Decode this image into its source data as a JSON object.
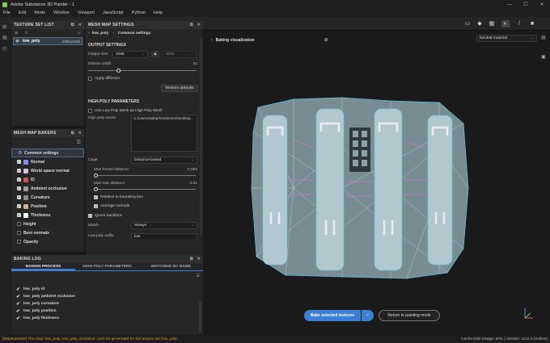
{
  "window": {
    "title": "Adobe Substance 3D Painter - 1",
    "controls": [
      "—",
      "☐",
      "✕"
    ]
  },
  "menu": [
    "File",
    "Edit",
    "Mode",
    "Window",
    "Viewport",
    "JavaScript",
    "Python",
    "Help"
  ],
  "texture_set_list": {
    "title": "TEXTURE SET LIST",
    "item": {
      "name": "low_poly",
      "resolution": "4096x4096"
    }
  },
  "mesh_map_bakers": {
    "title": "MESH MAP BAKERS",
    "items": [
      {
        "label": "Common settings",
        "checked": null,
        "color": "#7f9bd4"
      },
      {
        "label": "Normal",
        "checked": true,
        "color": "#8a8bf0"
      },
      {
        "label": "World space normal",
        "checked": true,
        "color": "#d7c2e8"
      },
      {
        "label": "ID",
        "checked": true,
        "color": "#c45a5a"
      },
      {
        "label": "Ambient occlusion",
        "checked": true,
        "color": "#9c9c9c"
      },
      {
        "label": "Curvature",
        "checked": true,
        "color": "#8c8c8c"
      },
      {
        "label": "Position",
        "checked": true,
        "color": "#d0b080"
      },
      {
        "label": "Thickness",
        "checked": true,
        "color": "#ffffff"
      },
      {
        "label": "Height",
        "checked": false,
        "color": ""
      },
      {
        "label": "Bent normals",
        "checked": false,
        "color": ""
      },
      {
        "label": "Opacity",
        "checked": false,
        "color": ""
      }
    ]
  },
  "mesh_map_settings": {
    "title": "MESH MAP SETTINGS",
    "breadcrumb": [
      "low_poly",
      "Common settings"
    ],
    "output": {
      "section": "OUTPUT SETTINGS",
      "size_label": "Output size",
      "size_value": "4096",
      "size_value2": "4096",
      "dilation_label": "Dilation width",
      "dilation_value": "32",
      "apply_diffusion": "Apply diffusion",
      "restore": "Restore defaults"
    },
    "high_poly": {
      "section": "HIGH-POLY PARAMETERS",
      "use_low": "Use Low Poly Mesh as High Poly Mesh",
      "scene_label": "High poly scene",
      "scene_value": "C:/Users/aditp/OneDrive/Desktop...",
      "cage_label": "Cage",
      "cage_value": "Distance-based",
      "max_front_label": "Max frontal distance",
      "max_front_value": "0.002",
      "max_rear_label": "Max rear distance",
      "max_rear_value": "0.01",
      "relative_bbox": "Relative to bounding box",
      "avg_normals": "Average normals",
      "ignore_backface": "Ignore backface",
      "match_label": "Match",
      "match_value": "Always",
      "low_suffix_label": "Low poly suffix",
      "low_suffix_value": "low"
    }
  },
  "baking_log": {
    "title": "BAKING LOG",
    "tabs": [
      "BAKING PROCESS",
      "HIGH POLY PARAMETERS",
      "MATCHING BY NAME"
    ],
    "entries": [
      "low_poly id",
      "low_poly ambient occlusion",
      "low_poly curvature",
      "low_poly position",
      "low_poly thickness"
    ]
  },
  "viewport": {
    "header": "Baking visualization",
    "material": "Neutral material",
    "bake_button": "Bake selected textures",
    "return_button": "Return to painting mode"
  },
  "status": {
    "message": "[MapExporter] The map 'low_poly_low_poly_Emissive' can't be generated for the texture set 'low_poly'.",
    "right": "Cache Disk Usage:   30% | Version: 12.0.3 (Vulkan)"
  },
  "colors": {
    "accent": "#3c7fd3",
    "warning": "#d4a520",
    "mesh_edge": "#5fc4e8"
  }
}
